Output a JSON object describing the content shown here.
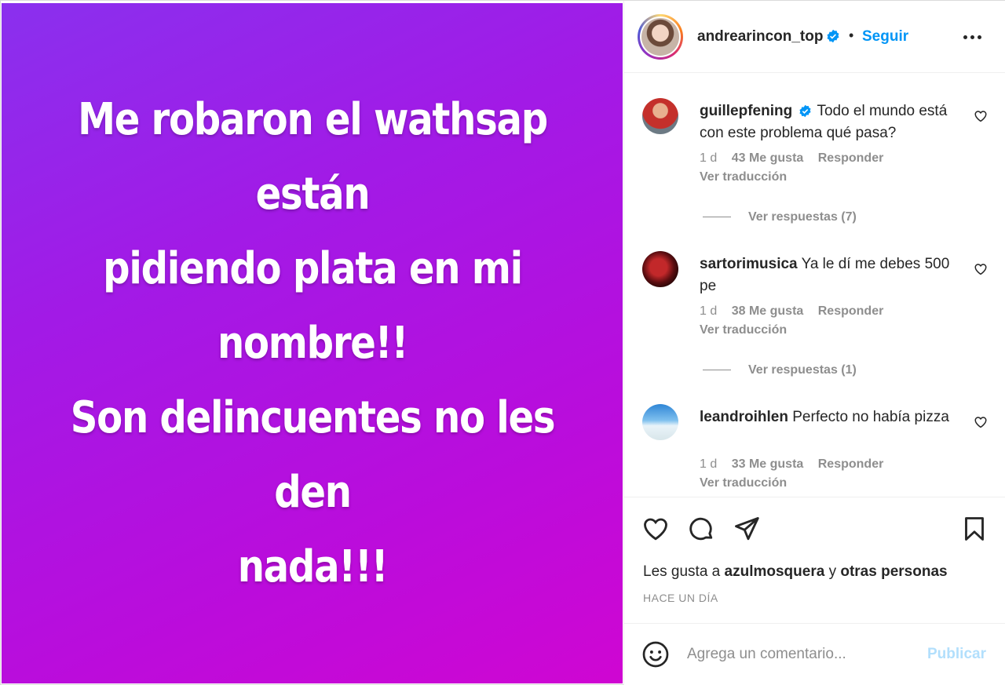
{
  "post": {
    "story_lines": [
      "Me robaron el wathsap están",
      "pidiendo plata en mi nombre!!",
      "Son delincuentes no les den",
      "nada!!!"
    ],
    "background_colors": [
      "#8a30ee",
      "#cf06d2"
    ]
  },
  "header": {
    "username": "andrearincon_top",
    "separator": "•",
    "follow_label": "Seguir",
    "icons": [
      "verified-badge-icon",
      "more-options-icon"
    ]
  },
  "comments": [
    {
      "username": "guillepfening",
      "verified": true,
      "text": "Todo el mundo está con este problema qué pasa?",
      "time": "1 d",
      "likes": "43 Me gusta",
      "reply_label": "Responder",
      "translate_label": "Ver traducción",
      "replies_label": "Ver respuestas (7)"
    },
    {
      "username": "sartorimusica",
      "verified": false,
      "text": "Ya le dí me debes 500 pe",
      "time": "1 d",
      "likes": "38 Me gusta",
      "reply_label": "Responder",
      "translate_label": "Ver traducción",
      "replies_label": "Ver respuestas (1)"
    },
    {
      "username": "leandroihlen",
      "verified": false,
      "text": "Perfecto no había pizza",
      "time": "1 d",
      "likes": "33 Me gusta",
      "reply_label": "Responder",
      "translate_label": "Ver traducción"
    }
  ],
  "actions": {
    "icons": [
      "heart-icon",
      "comment-icon",
      "share-icon",
      "bookmark-icon"
    ],
    "likes_prefix": "Les gusta a",
    "likes_user": "azulmosquera",
    "likes_conj": "y",
    "likes_others": "otras personas",
    "timestamp": "HACE UN DÍA"
  },
  "composer": {
    "placeholder": "Agrega un comentario...",
    "publish_label": "Publicar",
    "emoji_icon": "emoji-icon"
  },
  "colors": {
    "accent": "#0095f6",
    "muted": "#8e8e8e",
    "publish_disabled": "#b2dffc"
  }
}
